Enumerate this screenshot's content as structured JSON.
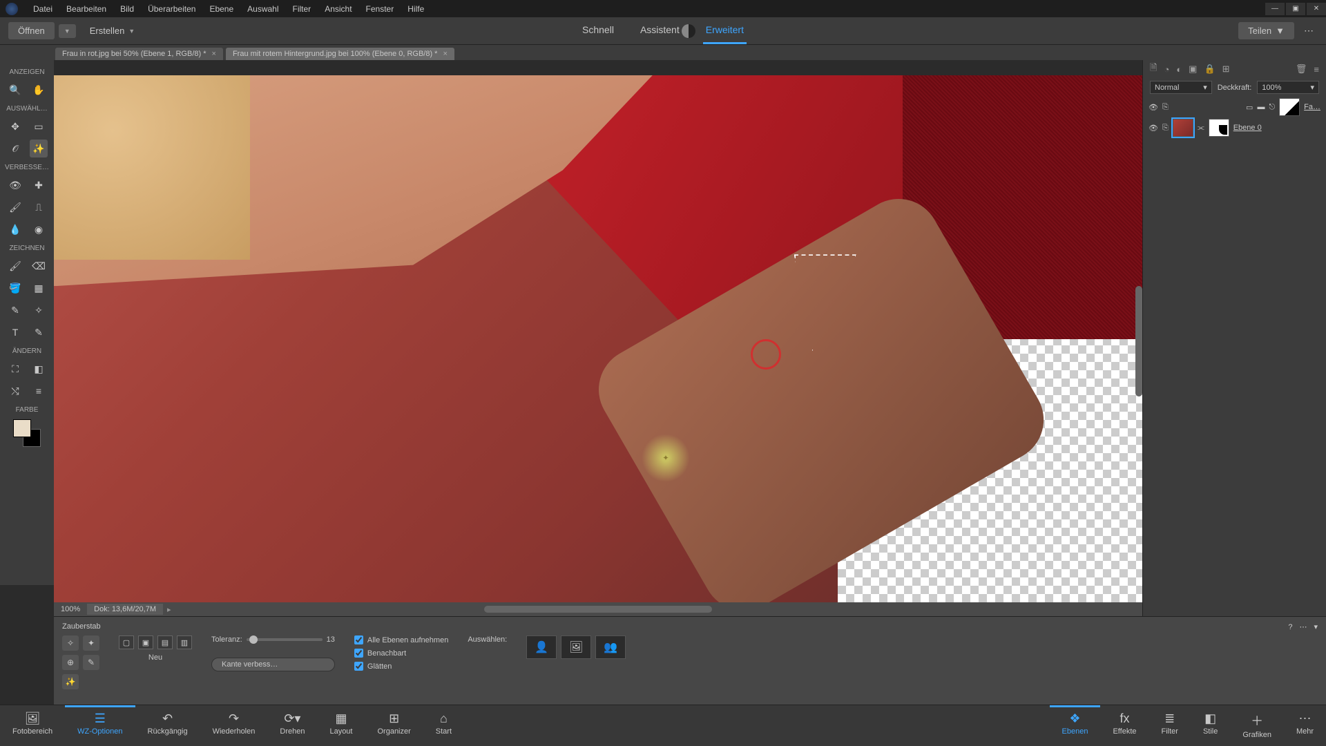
{
  "menu": [
    "Datei",
    "Bearbeiten",
    "Bild",
    "Überarbeiten",
    "Ebene",
    "Auswahl",
    "Filter",
    "Ansicht",
    "Fenster",
    "Hilfe"
  ],
  "secondbar": {
    "open": "Öffnen",
    "create": "Erstellen",
    "tabs": {
      "quick": "Schnell",
      "assist": "Assistent",
      "expert": "Erweitert"
    },
    "share": "Teilen"
  },
  "doctabs": [
    {
      "label": "Frau in rot.jpg bei 50% (Ebene 1, RGB/8) *"
    },
    {
      "label": "Frau mit rotem Hintergrund.jpg bei 100% (Ebene 0, RGB/8) *"
    }
  ],
  "left_sections": {
    "view": "ANZEIGEN",
    "select": "AUSWÄHL…",
    "enhance": "VERBESSE…",
    "draw": "ZEICHNEN",
    "modify": "ÄNDERN",
    "color": "FARBE"
  },
  "canvas_info": {
    "zoom": "100%",
    "doc": "Dok: 13,6M/20,7M"
  },
  "layers": {
    "blend": "Normal",
    "opacity_label": "Deckkraft:",
    "opacity": "100%",
    "layer1": "Fa…",
    "layer0": "Ebene 0"
  },
  "options": {
    "tool": "Zauberstab",
    "new": "Neu",
    "tol_label": "Toleranz:",
    "tol_value": "13",
    "all_layers": "Alle Ebenen aufnehmen",
    "contig": "Benachbart",
    "smooth": "Glätten",
    "refine": "Kante verbess…",
    "select_label": "Auswählen:"
  },
  "bottom": {
    "photo": "Fotobereich",
    "wz": "WZ-Optionen",
    "undo": "Rückgängig",
    "redo": "Wiederholen",
    "rotate": "Drehen",
    "layout": "Layout",
    "organizer": "Organizer",
    "home": "Start",
    "layers": "Ebenen",
    "effects": "Effekte",
    "filter": "Filter",
    "styles": "Stile",
    "graphics": "Grafiken",
    "more": "Mehr"
  }
}
